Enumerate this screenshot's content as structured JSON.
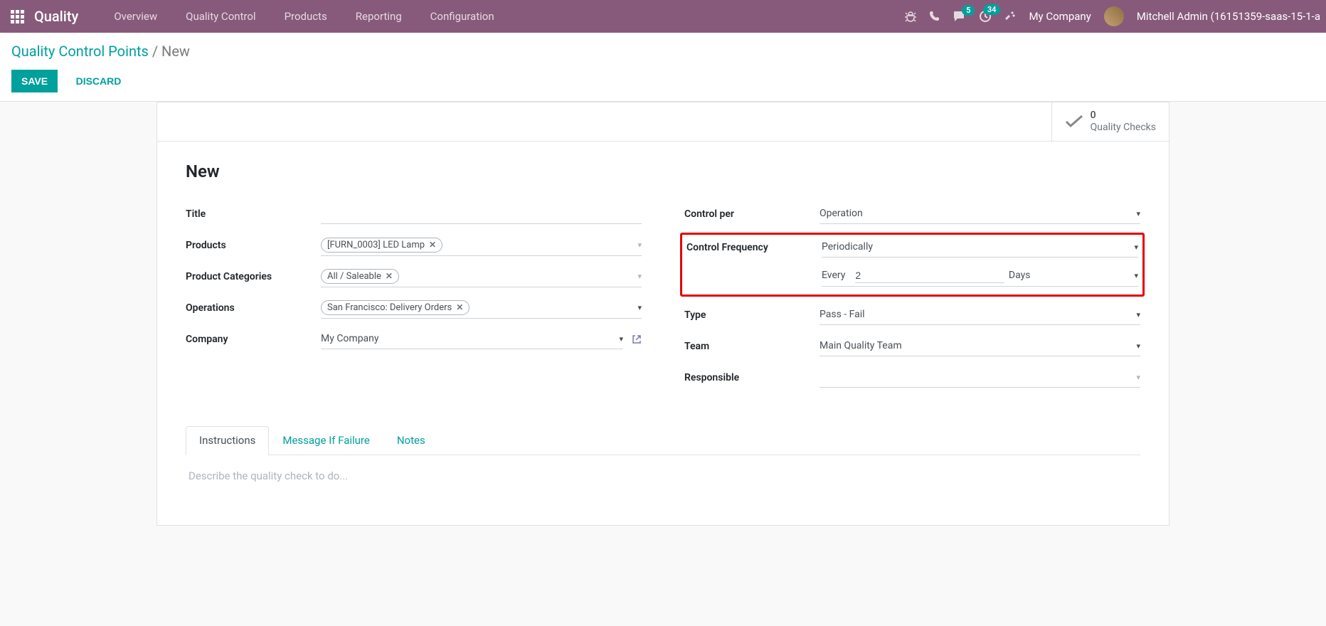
{
  "header": {
    "brand": "Quality",
    "nav": [
      "Overview",
      "Quality Control",
      "Products",
      "Reporting",
      "Configuration"
    ],
    "badges": {
      "messages": "5",
      "activities": "34"
    },
    "company": "My Company",
    "user": "Mitchell Admin (16151359-saas-15-1-a"
  },
  "breadcrumb": {
    "parent": "Quality Control Points",
    "current": "New"
  },
  "actions": {
    "save": "SAVE",
    "discard": "DISCARD"
  },
  "stat": {
    "value": "0",
    "label": "Quality Checks"
  },
  "form": {
    "title": "New",
    "left": {
      "title_label": "Title",
      "title_value": "",
      "products_label": "Products",
      "product_tag": "[FURN_0003] LED Lamp",
      "categories_label": "Product Categories",
      "category_tag": "All / Saleable",
      "operations_label": "Operations",
      "operation_tag": "San Francisco: Delivery Orders",
      "company_label": "Company",
      "company_value": "My Company"
    },
    "right": {
      "control_per_label": "Control per",
      "control_per_value": "Operation",
      "control_freq_label": "Control Frequency",
      "control_freq_value": "Periodically",
      "freq_every": "Every",
      "freq_number": "2",
      "freq_unit": "Days",
      "type_label": "Type",
      "type_value": "Pass - Fail",
      "team_label": "Team",
      "team_value": "Main Quality Team",
      "responsible_label": "Responsible",
      "responsible_value": ""
    }
  },
  "tabs": {
    "instructions": "Instructions",
    "message_if_failure": "Message If Failure",
    "notes": "Notes",
    "placeholder": "Describe the quality check to do..."
  }
}
